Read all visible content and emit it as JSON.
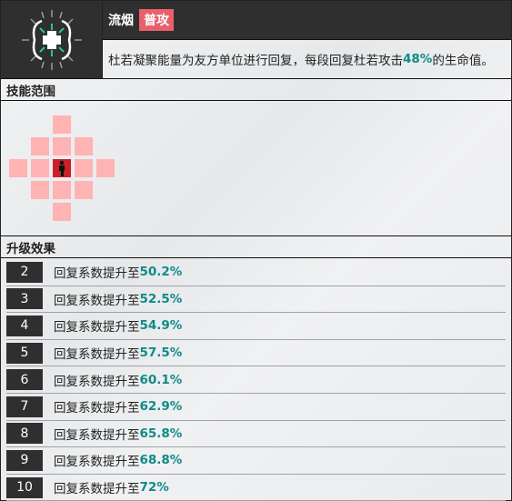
{
  "skill": {
    "name": "流烟",
    "type_badge": "普攻",
    "icon": "healing-plus-icon",
    "desc_pre": "杜若凝聚能量为友方单位进行回复，每段回复杜若攻击",
    "desc_value": "48%",
    "desc_post": "的生命值。"
  },
  "range": {
    "title": "技能范围",
    "cells": [
      [
        -2,
        0
      ],
      [
        -1,
        -1
      ],
      [
        -1,
        0
      ],
      [
        -1,
        1
      ],
      [
        0,
        -2
      ],
      [
        0,
        -1
      ],
      [
        0,
        1
      ],
      [
        0,
        2
      ],
      [
        1,
        -1
      ],
      [
        1,
        0
      ],
      [
        1,
        1
      ],
      [
        2,
        0
      ]
    ],
    "self": [
      0,
      0
    ]
  },
  "upgrades": {
    "title": "升级效果",
    "prefix": "回复系数提升至",
    "items": [
      {
        "level": "2",
        "value": "50.2%"
      },
      {
        "level": "3",
        "value": "52.5%"
      },
      {
        "level": "4",
        "value": "54.9%"
      },
      {
        "level": "5",
        "value": "57.5%"
      },
      {
        "level": "6",
        "value": "60.1%"
      },
      {
        "level": "7",
        "value": "62.9%"
      },
      {
        "level": "8",
        "value": "65.8%"
      },
      {
        "level": "9",
        "value": "68.8%"
      },
      {
        "level": "10",
        "value": "72%"
      }
    ]
  },
  "colors": {
    "accent": "#0f8a8a",
    "badge": "#e8606a",
    "range_cell": "#ffb3b3",
    "self_cell": "#cc1f2a"
  }
}
